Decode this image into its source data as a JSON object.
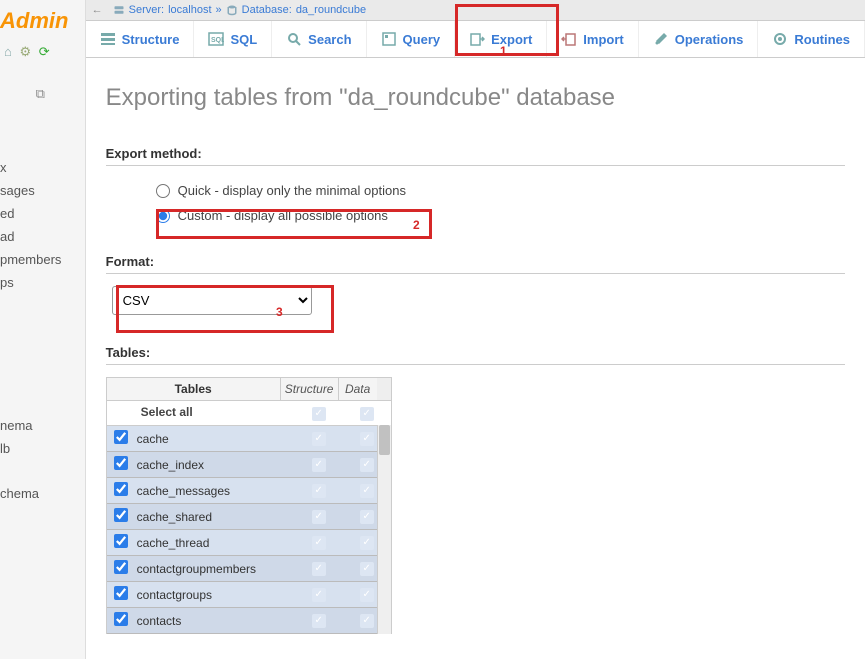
{
  "logo": "Admin",
  "breadcrumb": {
    "server_label": "Server:",
    "server_value": "localhost",
    "sep": "»",
    "db_label": "Database:",
    "db_value": "da_roundcube"
  },
  "tabs": [
    {
      "label": "Structure"
    },
    {
      "label": "SQL"
    },
    {
      "label": "Search"
    },
    {
      "label": "Query"
    },
    {
      "label": "Export"
    },
    {
      "label": "Import"
    },
    {
      "label": "Operations"
    },
    {
      "label": "Routines"
    }
  ],
  "title": "Exporting tables from \"da_roundcube\" database",
  "export_method_label": "Export method:",
  "export_method": {
    "quick": "Quick - display only the minimal options",
    "custom": "Custom - display all possible options",
    "selected": "custom"
  },
  "format_label": "Format:",
  "format_value": "CSV",
  "tables_label": "Tables:",
  "tables_header": {
    "name": "Tables",
    "structure": "Structure",
    "data": "Data"
  },
  "select_all": "Select all",
  "tables": [
    "cache",
    "cache_index",
    "cache_messages",
    "cache_shared",
    "cache_thread",
    "contactgroupmembers",
    "contactgroups",
    "contacts"
  ],
  "sidebar_items_a": [
    "x",
    "sages",
    "ed",
    "ad",
    "pmembers",
    "ps"
  ],
  "sidebar_items_b": [
    "nema",
    "lb"
  ],
  "sidebar_items_c": [
    "chema"
  ],
  "annotations": {
    "a1": "1",
    "a2": "2",
    "a3": "3"
  }
}
